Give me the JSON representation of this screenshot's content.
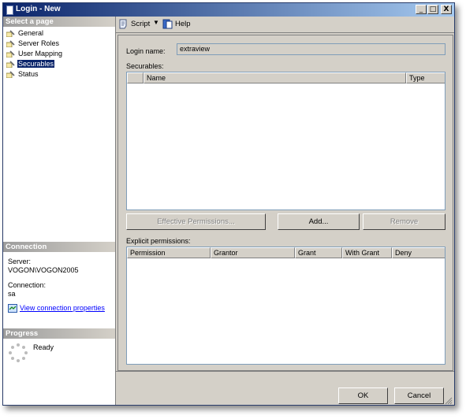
{
  "window": {
    "title": "Login - New",
    "minimize": "_",
    "maximize": "□",
    "close": "X"
  },
  "sidebar": {
    "select_header": "Select a page",
    "items": [
      {
        "label": "General",
        "selected": false
      },
      {
        "label": "Server Roles",
        "selected": false
      },
      {
        "label": "User Mapping",
        "selected": false
      },
      {
        "label": "Securables",
        "selected": true
      },
      {
        "label": "Status",
        "selected": false
      }
    ],
    "connection_header": "Connection",
    "server_label": "Server:",
    "server_value": "VOGON\\VOGON2005",
    "connection_label": "Connection:",
    "connection_value": "sa",
    "view_props_link": "View connection properties",
    "progress_header": "Progress",
    "progress_status": "Ready"
  },
  "toolbar": {
    "script_label": "Script",
    "help_label": "Help"
  },
  "form": {
    "login_name_label": "Login name:",
    "login_name_value": "extraview",
    "securables_label": "Securables:",
    "securables_columns": [
      "Name",
      "Type"
    ],
    "effective_permissions_button": "Effective Permissions...",
    "add_button": "Add...",
    "remove_button": "Remove",
    "explicit_permissions_label": "Explicit permissions:",
    "permissions_columns": [
      "Permission",
      "Grantor",
      "Grant",
      "With Grant",
      "Deny"
    ]
  },
  "footer": {
    "ok_label": "OK",
    "cancel_label": "Cancel"
  },
  "colors": {
    "title_bar": "#0a246a",
    "selected": "#0a246a",
    "link": "#0000ff",
    "face": "#d4d0c8"
  }
}
